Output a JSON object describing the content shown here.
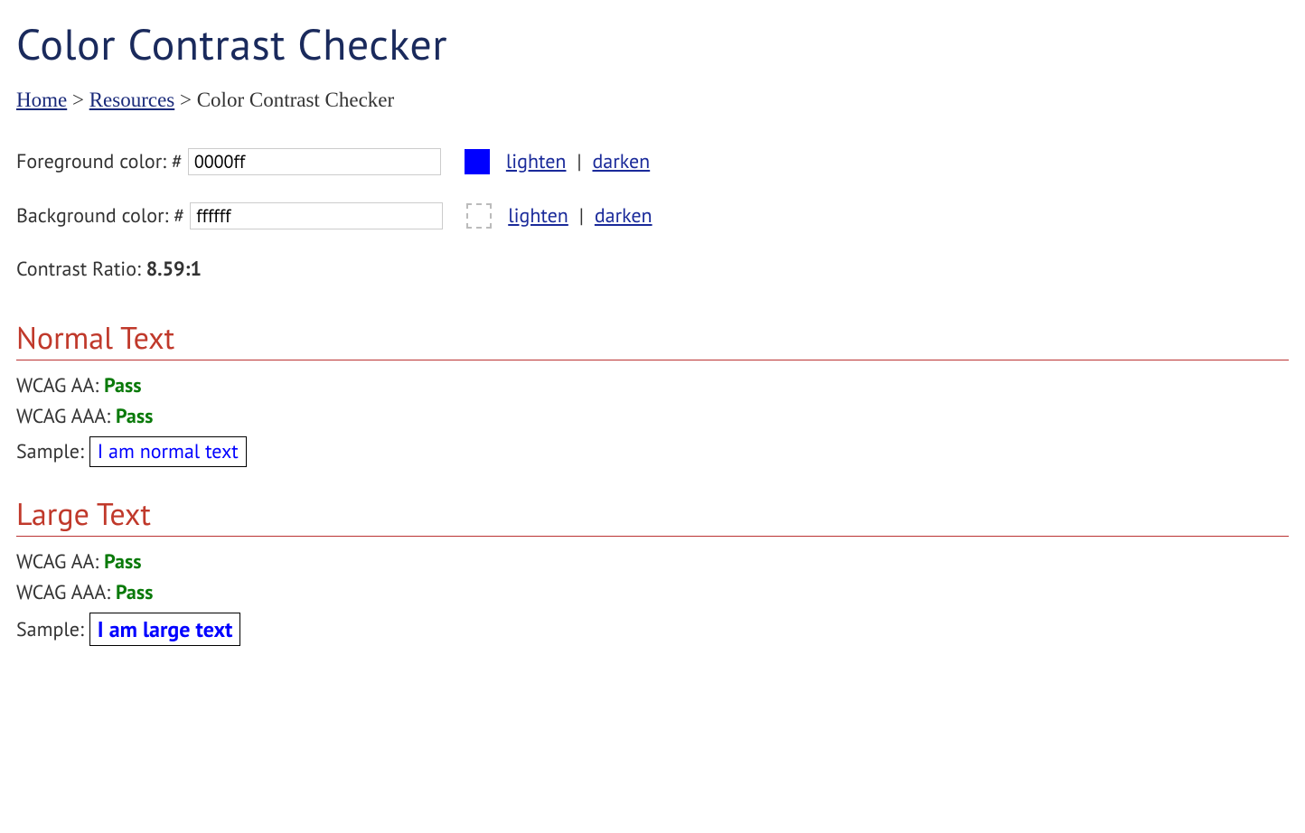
{
  "title": "Color Contrast Checker",
  "breadcrumb": {
    "home": "Home",
    "resources": "Resources",
    "current": "Color Contrast Checker",
    "sep": ">"
  },
  "foreground": {
    "label": "Foreground color: #",
    "value": "0000ff",
    "hex": "#0000ff",
    "lighten": "lighten",
    "darken": "darken"
  },
  "background": {
    "label": "Background color: #",
    "value": "ffffff",
    "hex": "#ffffff",
    "lighten": "lighten",
    "darken": "darken"
  },
  "ratio": {
    "label": "Contrast Ratio: ",
    "value": "8.59:1"
  },
  "normal": {
    "heading": "Normal Text",
    "aa_label": "WCAG AA: ",
    "aa_result": "Pass",
    "aaa_label": "WCAG AAA: ",
    "aaa_result": "Pass",
    "sample_label": "Sample: ",
    "sample_text": "I am normal text"
  },
  "large": {
    "heading": "Large Text",
    "aa_label": "WCAG AA: ",
    "aa_result": "Pass",
    "aaa_label": "WCAG AAA: ",
    "aaa_result": "Pass",
    "sample_label": "Sample: ",
    "sample_text": "I am large text"
  },
  "divider": "|"
}
